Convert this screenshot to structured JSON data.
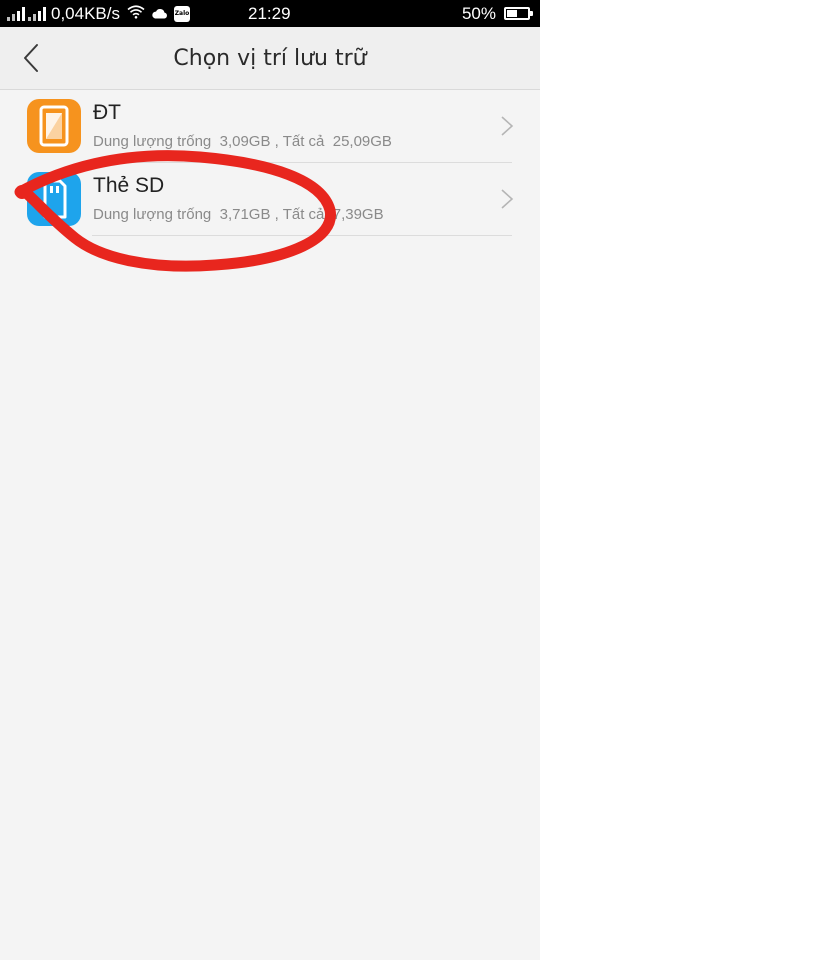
{
  "status_bar": {
    "network_speed": "0,04KB/s",
    "zalo_label": "Zalo",
    "time": "21:29",
    "battery_percent": "50%",
    "battery_level": 0.5
  },
  "header": {
    "title": "Chọn vị trí lưu trữ",
    "back_icon": "chevron-left-icon"
  },
  "storage_options": [
    {
      "title": "ĐT",
      "subtitle": "Dung lượng trống  3,09GB , Tất cả  25,09GB",
      "icon": "phone-storage-icon",
      "color": "#f6931e"
    },
    {
      "title": "Thẻ SD",
      "subtitle": "Dung lượng trống  3,71GB , Tất cả  7,39GB",
      "icon": "sd-card-icon",
      "color": "#1ea4ec"
    }
  ],
  "annotation": {
    "type": "hand-drawn-circle",
    "color": "#e8261e"
  }
}
